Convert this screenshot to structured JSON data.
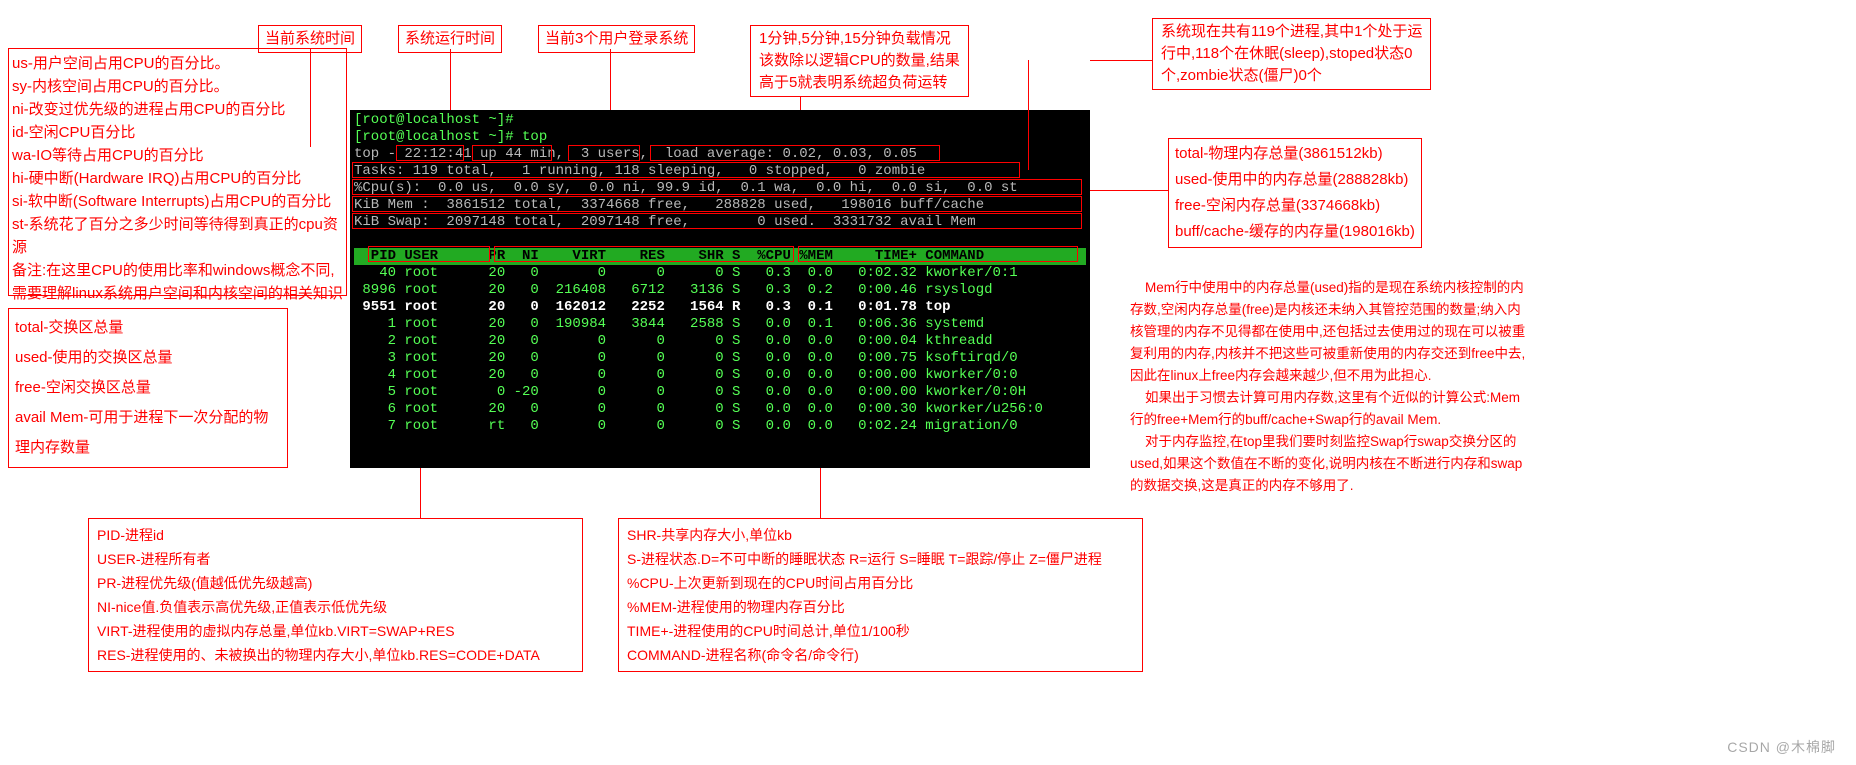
{
  "top_labels": {
    "time": "当前系统时间",
    "uptime": "系统运行时间",
    "users": "当前3个用户登录系统",
    "load_l1": "1分钟,5分钟,15分钟负载情况",
    "load_l2": "该数除以逻辑CPU的数量,结果",
    "load_l3": "高于5就表明系统超负荷运转",
    "tasks_l1": "系统现在共有119个进程,其中1个处于运",
    "tasks_l2": "行中,118个在休眠(sleep),stoped状态0",
    "tasks_l3": "个,zombie状态(僵尸)0个"
  },
  "cpu_expl": [
    "us-用户空间占用CPU的百分比。",
    "sy-内核空间占用CPU的百分比。",
    "ni-改变过优先级的进程占用CPU的百分比",
    "id-空闲CPU百分比",
    "wa-IO等待占用CPU的百分比",
    "hi-硬中断(Hardware IRQ)占用CPU的百分比",
    "si-软中断(Software Interrupts)占用CPU的百分比",
    "st-系统花了百分之多少时间等待得到真正的cpu资源",
    "备注:在这里CPU的使用比率和windows概念不同,需要理解linux系统用户空间和内核空间的相关知识"
  ],
  "swap_expl": [
    "total-交换区总量",
    "used-使用的交换区总量",
    "free-空闲交换区总量",
    "avail Mem-可用于进程下一次分配的物理内存数量"
  ],
  "mem_expl": [
    "total-物理内存总量(3861512kb)",
    "used-使用中的内存总量(288828kb)",
    "free-空闲内存总量(3374668kb)",
    "buff/cache-缓存的内存量(198016kb)"
  ],
  "mem_para": "    Mem行中使用中的内存总量(used)指的是现在系统内核控制的内存数,空闲内存总量(free)是内核还未纳入其管控范围的数量;纳入内核管理的内存不见得都在使用中,还包括过去使用过的现在可以被重复利用的内存,内核并不把这些可被重新使用的内存交还到free中去,因此在linux上free内存会越来越少,但不用为此担心.\n    如果出于习惯去计算可用内存数,这里有个近似的计算公式:Mem行的free+Mem行的buff/cache+Swap行的avail Mem.\n    对于内存监控,在top里我们要时刻监控Swap行swap交换分区的used,如果这个数值在不断的变化,说明内核在不断进行内存和swap的数据交换,这是真正的内存不够用了.",
  "col_left": [
    "PID-进程id",
    "USER-进程所有者",
    "PR-进程优先级(值越低优先级越高)",
    "NI-nice值.负值表示高优先级,正值表示低优先级",
    "VIRT-进程使用的虚拟内存总量,单位kb.VIRT=SWAP+RES",
    "RES-进程使用的、未被换出的物理内存大小,单位kb.RES=CODE+DATA"
  ],
  "col_right": [
    "SHR-共享内存大小,单位kb",
    "S-进程状态.D=不可中断的睡眠状态 R=运行 S=睡眠 T=跟踪/停止 Z=僵尸进程",
    "%CPU-上次更新到现在的CPU时间占用百分比",
    "%MEM-进程使用的物理内存百分比",
    "TIME+-进程使用的CPU时间总计,单位1/100秒",
    "COMMAND-进程名称(命令名/命令行)"
  ],
  "terminal": {
    "prompt1": "[root@localhost ~]#",
    "prompt2": "[root@localhost ~]# top",
    "summary_time": "top - 22:12:41 up 44 min,  3 users,  load average: 0.02, 0.03, 0.05",
    "summary_tasks": "Tasks: 119 total,   1 running, 118 sleeping,   0 stopped,   0 zombie",
    "summary_cpu": "%Cpu(s):  0.0 us,  0.0 sy,  0.0 ni, 99.9 id,  0.1 wa,  0.0 hi,  0.0 si,  0.0 st",
    "summary_mem": "KiB Mem :  3861512 total,  3374668 free,   288828 used,   198016 buff/cache",
    "summary_swap": "KiB Swap:  2097148 total,  2097148 free,        0 used.  3331732 avail Mem",
    "header": "  PID USER      PR  NI    VIRT    RES    SHR S  %CPU %MEM     TIME+ COMMAND        ",
    "rows": [
      "   40 root      20   0       0      0      0 S   0.3  0.0   0:02.32 kworker/0:1",
      " 8996 root      20   0  216408   6712   3136 S   0.3  0.2   0:00.46 rsyslogd",
      " 9551 root      20   0  162012   2252   1564 R   0.3  0.1   0:01.78 top",
      "    1 root      20   0  190984   3844   2588 S   0.0  0.1   0:06.36 systemd",
      "    2 root      20   0       0      0      0 S   0.0  0.0   0:00.04 kthreadd",
      "    3 root      20   0       0      0      0 S   0.0  0.0   0:00.75 ksoftirqd/0",
      "    4 root      20   0       0      0      0 S   0.0  0.0   0:00.00 kworker/0:0",
      "    5 root       0 -20       0      0      0 S   0.0  0.0   0:00.00 kworker/0:0H",
      "    6 root      20   0       0      0      0 S   0.0  0.0   0:00.30 kworker/u256:0",
      "    7 root      rt   0       0      0      0 S   0.0  0.0   0:02.24 migration/0"
    ]
  },
  "watermark": "CSDN @木棉脚"
}
